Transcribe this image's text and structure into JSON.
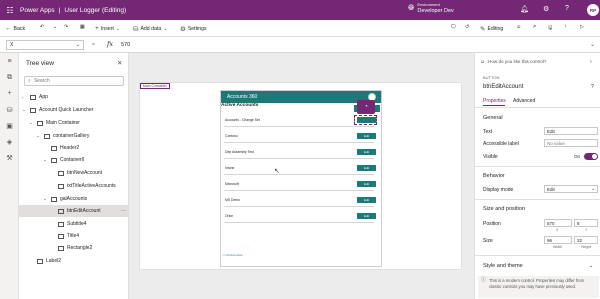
{
  "app": {
    "brand": "Power Apps",
    "doc_title": "User Logger (Editing)",
    "env_label": "Environment",
    "env_name": "Developer Dev",
    "avatar": "RP"
  },
  "toolbar": {
    "back": "Back",
    "insert": "Insert",
    "add_data": "Add data",
    "settings": "Settings",
    "editing": "Editing"
  },
  "formula": {
    "property": "X",
    "fx": "fx",
    "value": "570"
  },
  "tree": {
    "title": "Tree view",
    "search_placeholder": "Search",
    "items": [
      {
        "label": "App"
      },
      {
        "label": "Account Quick Launcher"
      },
      {
        "label": "Main Container"
      },
      {
        "label": "containerGallery"
      },
      {
        "label": "Header2"
      },
      {
        "label": "Container6"
      },
      {
        "label": "btnNewAccount"
      },
      {
        "label": "txtTitleActiveAccounts"
      },
      {
        "label": "galAccounts"
      },
      {
        "label": "btnEditAccount"
      },
      {
        "label": "Subtitle4"
      },
      {
        "label": "Title4"
      },
      {
        "label": "Rectangle2"
      },
      {
        "label": "Label2"
      }
    ]
  },
  "canvas": {
    "container_tag": "Main Container",
    "app_header": "Accounts 360",
    "active_header": "Active Accounts",
    "accounts": [
      "Accounts - Change Set",
      "Contoso",
      "Dep Assembly Test",
      "Intune",
      "Microsoft",
      "MS Demo",
      "Orion"
    ],
    "edit_label": "Edit",
    "all_accounts": "<< All Accounts"
  },
  "properties": {
    "feedback": "How do you like this control?",
    "type": "BUTTON",
    "name": "btnEditAccount",
    "tabs": [
      "Properties",
      "Advanced"
    ],
    "general": "General",
    "text_label": "Text",
    "text_value": "Edit",
    "access_label": "Accessible label",
    "access_value": "No value",
    "visible_label": "Visible",
    "visible_value": "On",
    "behavior": "Behavior",
    "display_mode_label": "Display mode",
    "display_mode_value": "Edit",
    "size_pos": "Size and position",
    "position_label": "Position",
    "x": "570",
    "y": "8",
    "x_label": "X",
    "y_label": "Y",
    "size_label": "Size",
    "w": "96",
    "h": "32",
    "w_label": "Width",
    "h_label": "Height",
    "style": "Style and theme",
    "notice": "This is a modern control. Properties may differ from classic controls you may have previously used."
  },
  "colors": {
    "brand": "#742774",
    "teal": "#1b7a78"
  }
}
